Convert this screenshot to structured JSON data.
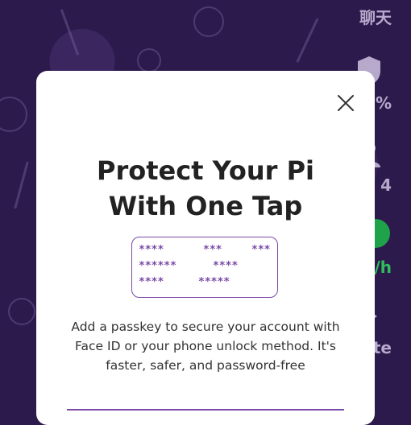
{
  "background": {
    "color": "#2c1a4c",
    "right_rail": {
      "chat_label": "聊天",
      "security_percent": "%",
      "user_count": "4",
      "mining_rate": "π/h",
      "invite_label": "te"
    }
  },
  "modal": {
    "title": "Protect Your Pi With One Tap",
    "passkey_masks": [
      "****",
      "***",
      "***",
      "******",
      "****",
      "****",
      "*****"
    ],
    "description": "Add a passkey to secure your account with Face ID or your phone unlock method. It's faster, safer, and password-free",
    "accent_color": "#7a4aa8"
  }
}
